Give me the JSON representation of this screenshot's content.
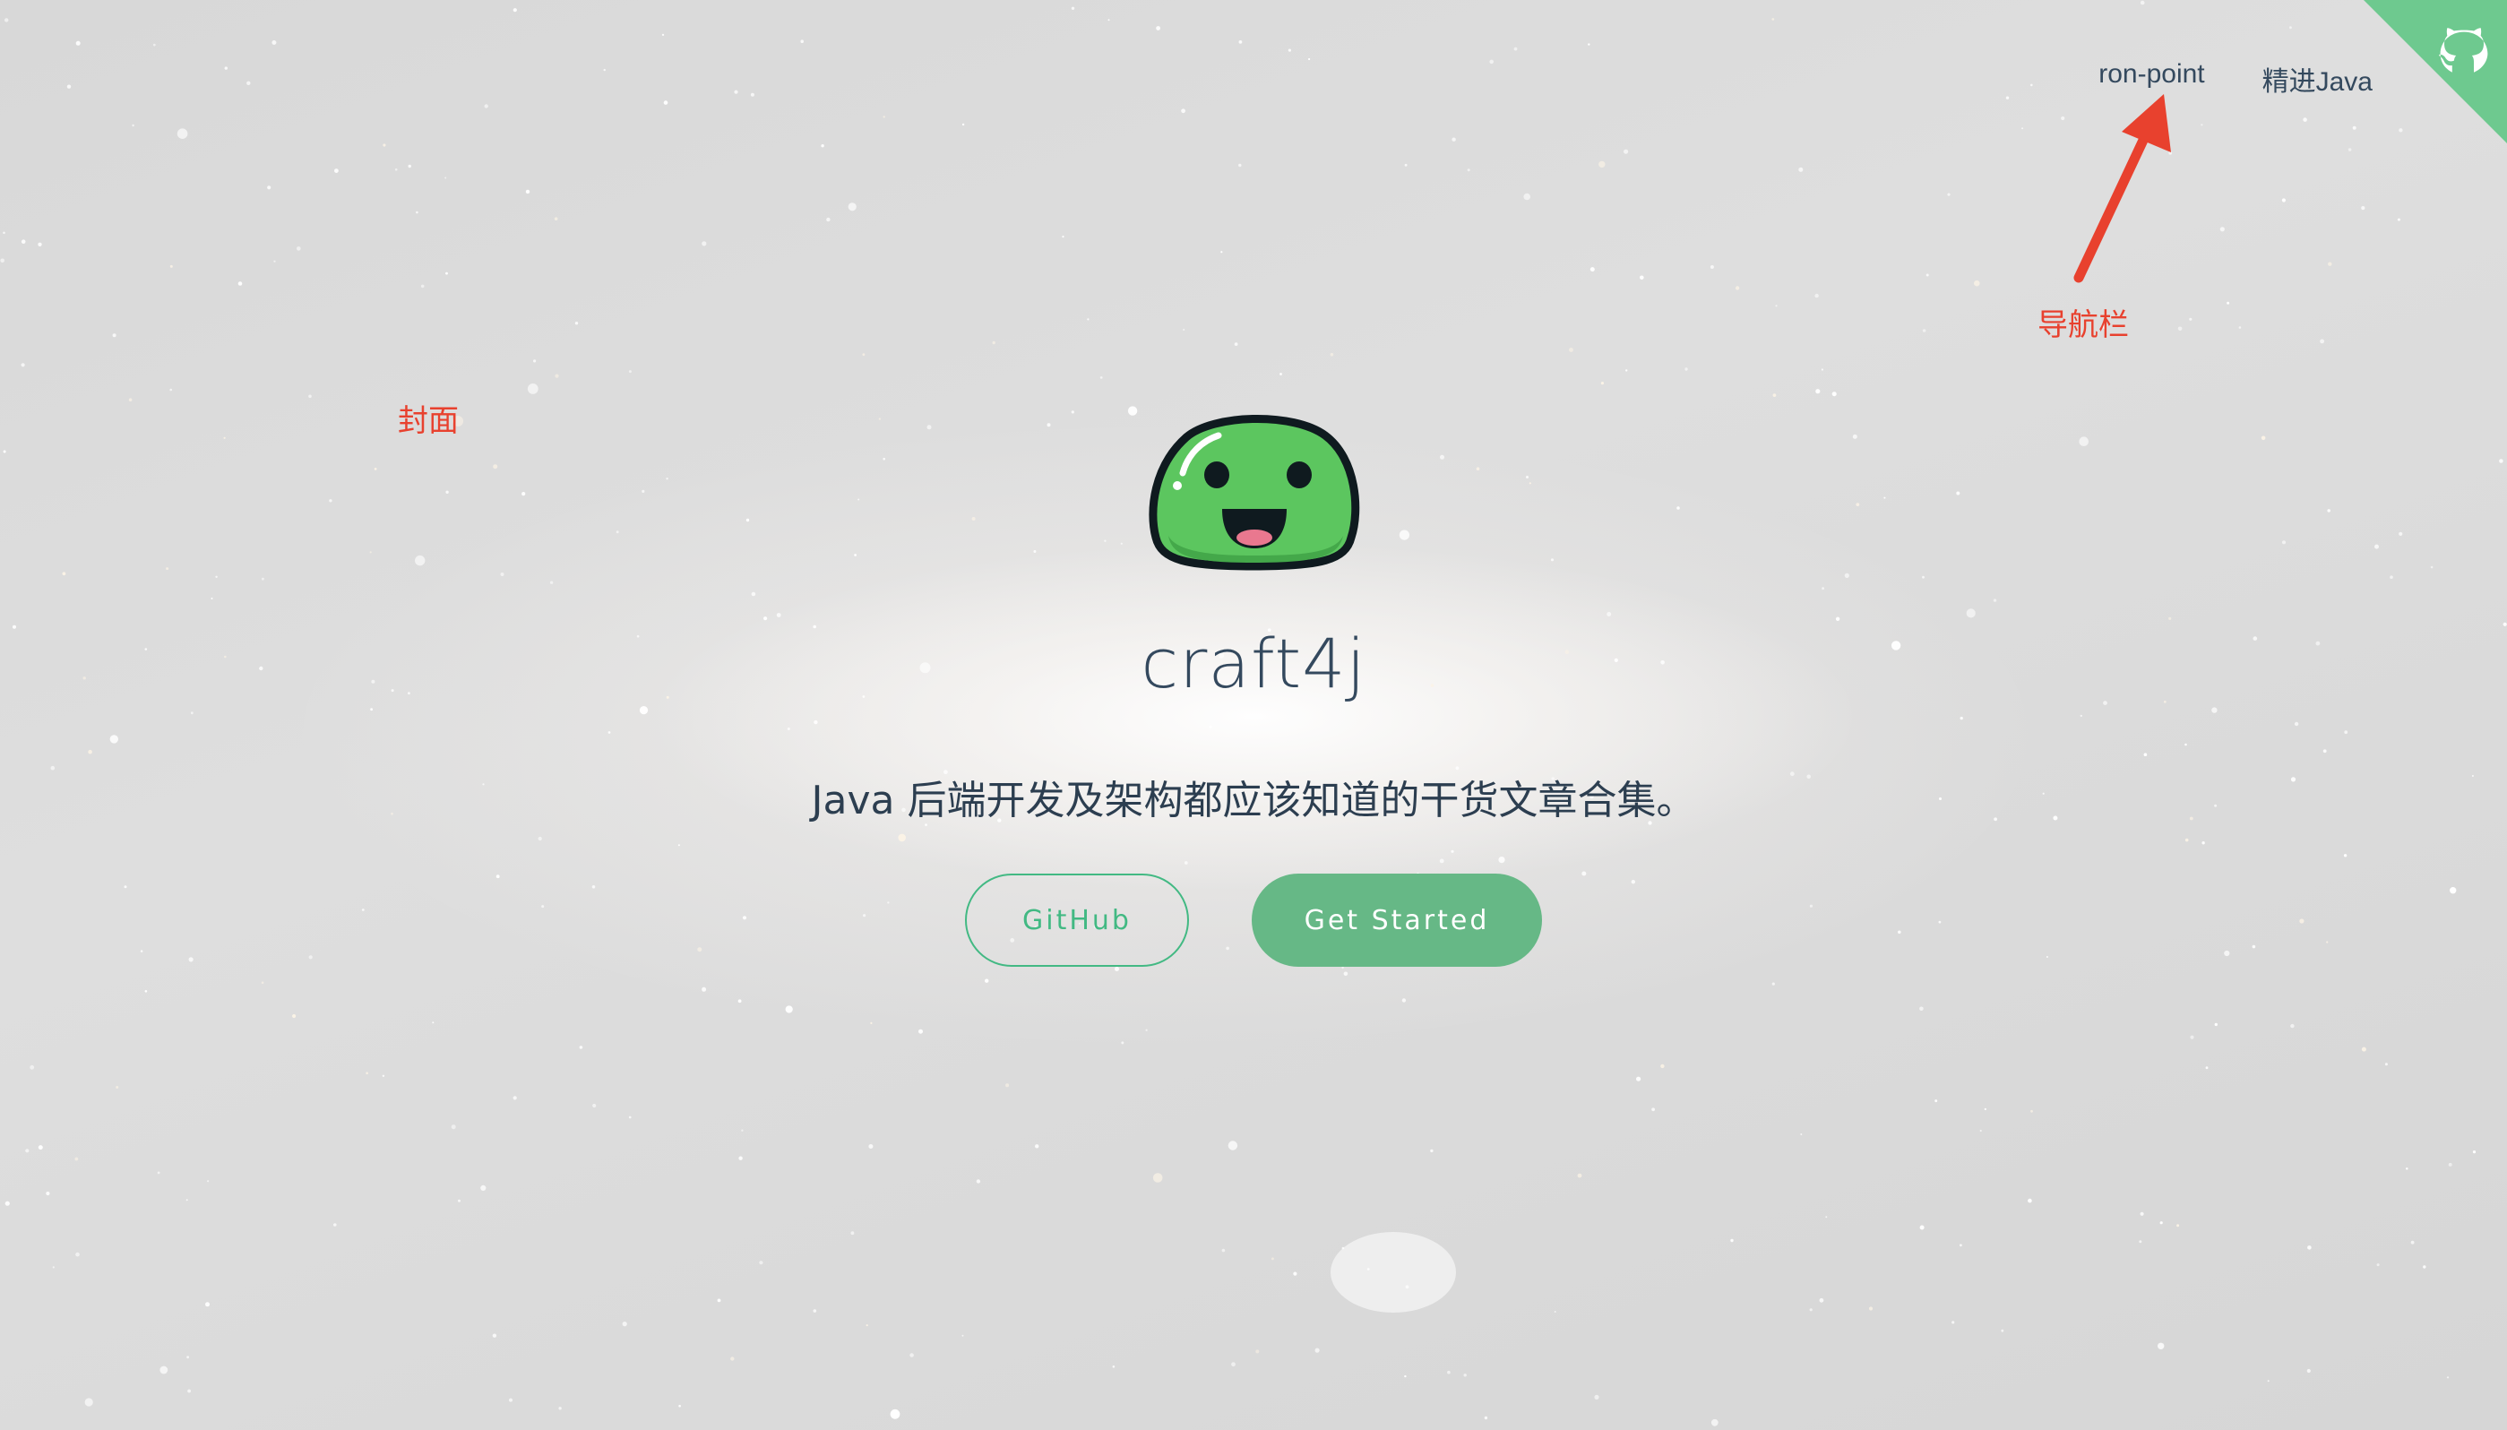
{
  "nav": {
    "items": [
      {
        "label": "ron-point"
      },
      {
        "label": "精进Java"
      }
    ]
  },
  "annotations": {
    "cover": "封面",
    "navbar": "导航栏"
  },
  "cover": {
    "title": "craft4j",
    "description": "Java 后端开发及架构都应该知道的干货文章合集。",
    "buttons": {
      "github": "GitHub",
      "start": "Get Started"
    }
  },
  "icons": {
    "corner": "github-octocat-icon",
    "mascot": "green-slime-mascot"
  },
  "colors": {
    "accent": "#42b983",
    "button_fill": "#66b886",
    "annotation": "#e8412e",
    "text": "#34495e"
  }
}
